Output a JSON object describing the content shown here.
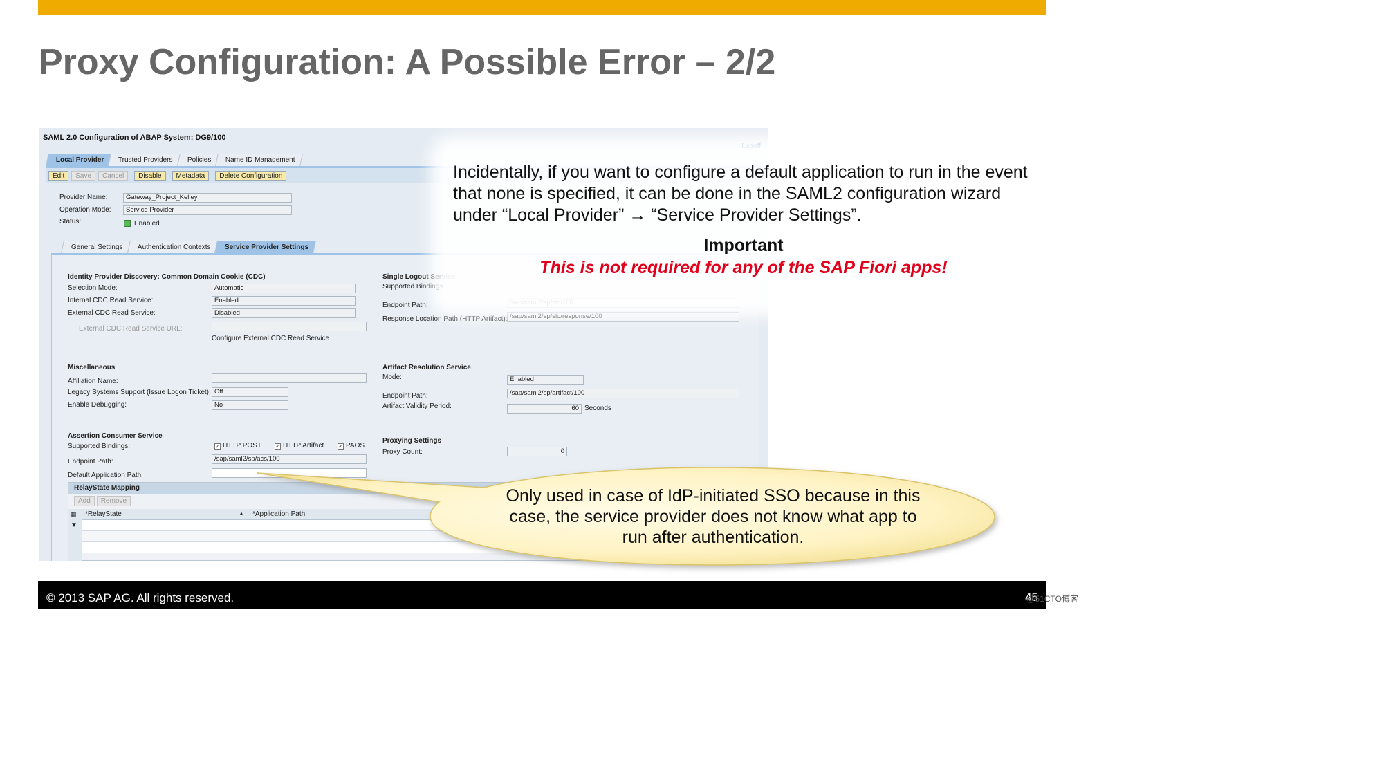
{
  "slide": {
    "title": "Proxy Configuration: A Possible Error – 2/2",
    "footer_copyright": "©  2013 SAP AG. All rights reserved.",
    "page_number": "45",
    "watermark": "@51CTO博客",
    "accent_color": "#f0ab00"
  },
  "screenshot": {
    "title": "SAML 2.0 Configuration of ABAP System: DG9/100",
    "logoff": "Logoff",
    "tabs": [
      "Local Provider",
      "Trusted Providers",
      "Policies",
      "Name ID Management"
    ],
    "active_tab": "Local Provider",
    "toolbar": {
      "edit": "Edit",
      "save": "Save",
      "cancel": "Cancel",
      "disable": "Disable",
      "metadata": "Metadata",
      "delete_configuration": "Delete Configuration"
    },
    "provider_name_label": "Provider Name:",
    "provider_name_value": "Gateway_Project_Kelley",
    "operation_mode_label": "Operation Mode:",
    "operation_mode_value": "Service Provider",
    "status_label": "Status:",
    "status_value": "Enabled",
    "subtabs": [
      "General Settings",
      "Authentication Contexts",
      "Service Provider Settings"
    ],
    "active_subtab": "Service Provider Settings",
    "cdc": {
      "heading": "Identity Provider Discovery: Common Domain Cookie (CDC)",
      "selection_mode_label": "Selection Mode:",
      "selection_mode_value": "Automatic",
      "internal_label": "Internal CDC Read Service:",
      "internal_value": "Enabled",
      "external_label": "External CDC Read Service:",
      "external_value": "Disabled",
      "external_url_label": "External CDC Read Service URL:",
      "configure_link": "Configure External CDC Read Service"
    },
    "slo": {
      "heading": "Single Logout Service",
      "bindings_label": "Supported Bindings:",
      "endpoint_label": "Endpoint Path:",
      "endpoint_value": "/sap/saml2/sp/slo/100",
      "response_label": "Response Location Path (HTTP Artifact):",
      "response_value": "/sap/saml2/sp/slo/response/100"
    },
    "misc": {
      "heading": "Miscellaneous",
      "affiliation_label": "Affiliation Name:",
      "legacy_label": "Legacy Systems Support (Issue Logon Ticket):",
      "legacy_value": "Off",
      "debug_label": "Enable Debugging:",
      "debug_value": "No"
    },
    "artifact": {
      "heading": "Artifact Resolution Service",
      "mode_label": "Mode:",
      "mode_value": "Enabled",
      "endpoint_label": "Endpoint Path:",
      "endpoint_value": "/sap/saml2/sp/artifact/100",
      "validity_label": "Artifact Validity Period:",
      "validity_value": "60",
      "validity_unit": "Seconds"
    },
    "acs": {
      "heading": "Assertion Consumer Service",
      "bindings_label": "Supported Bindings:",
      "binding_post": "HTTP POST",
      "binding_artifact": "HTTP Artifact",
      "binding_paos": "PAOS",
      "endpoint_label": "Endpoint Path:",
      "endpoint_value": "/sap/saml2/sp/acs/100",
      "default_app_label": "Default Application Path:"
    },
    "proxy": {
      "heading": "Proxying Settings",
      "count_label": "Proxy Count:",
      "count_value": "0"
    },
    "relay": {
      "heading": "RelayState Mapping",
      "add": "Add",
      "remove": "Remove",
      "col_relaystate": "*RelayState",
      "col_app_path": "*Application Path"
    }
  },
  "note": {
    "text": "Incidentally, if you want to configure a default application to run in the event that none is specified, it can be done in the SAML2 configuration wizard under “Local Provider” → “Service Provider Settings”.",
    "important_heading": "Important",
    "important_text": "This is not required for any of the SAP Fiori apps!"
  },
  "callout": {
    "text": "Only used in case of IdP-initiated SSO because in this case, the service provider does not know what app to run after authentication."
  }
}
